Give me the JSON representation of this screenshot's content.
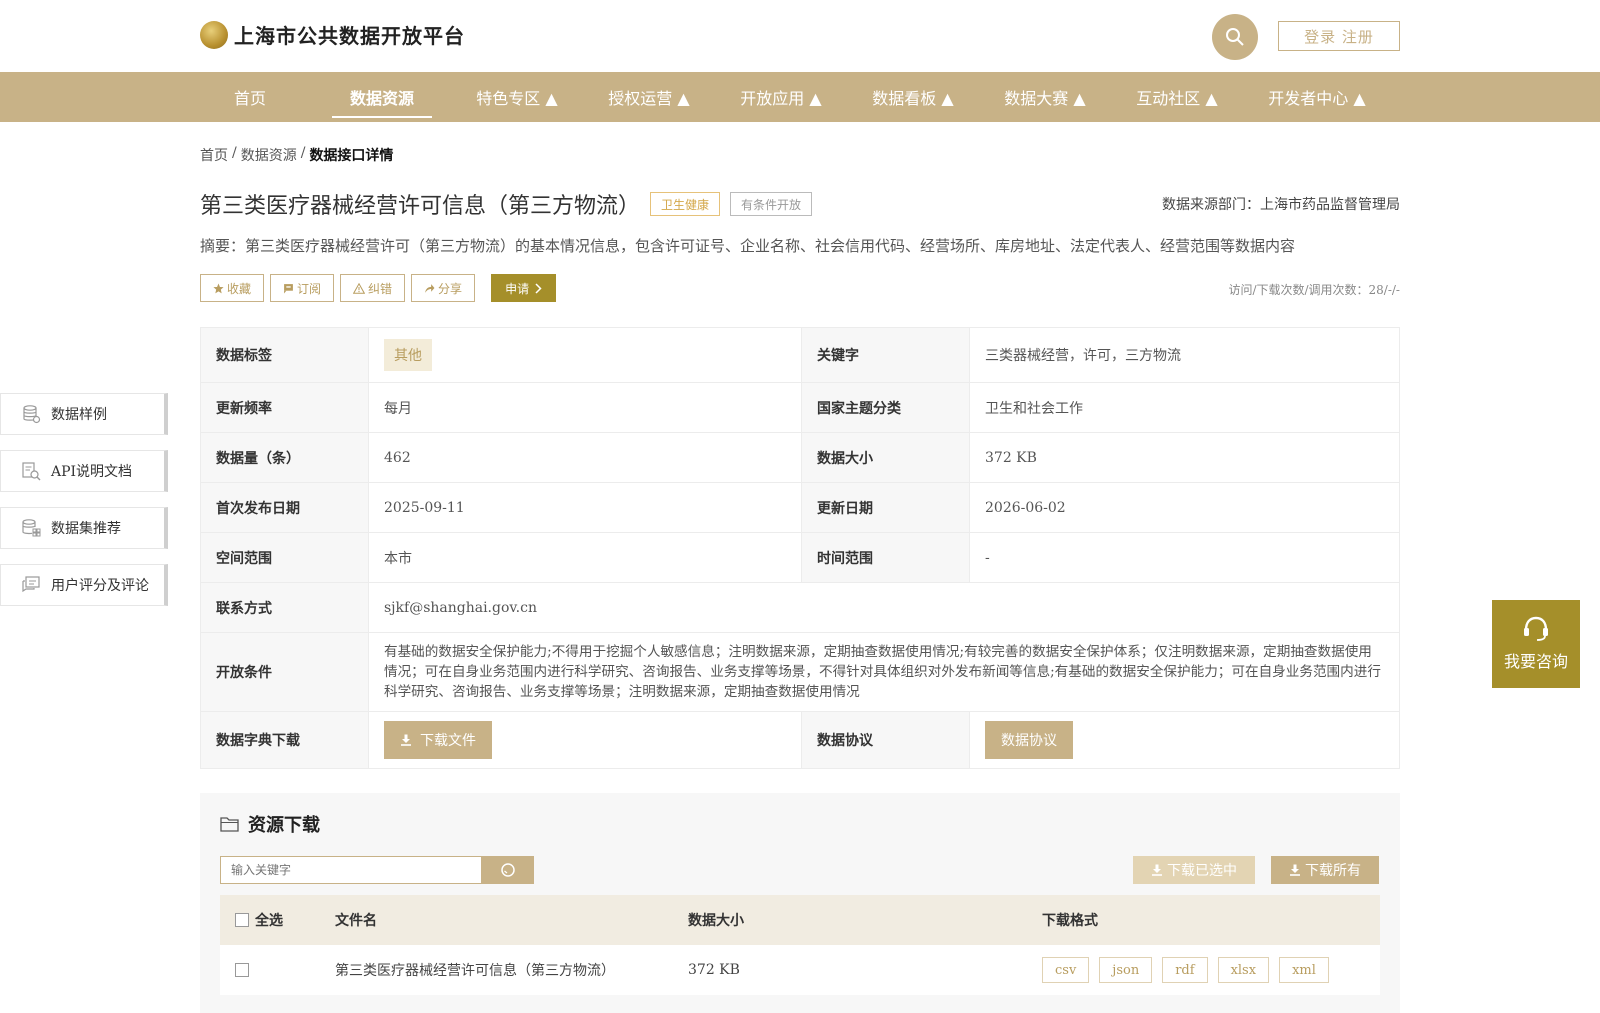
{
  "header": {
    "logo_text": "上海市公共数据开放平台",
    "search_icon": "search-icon",
    "login_label": "登录 注册"
  },
  "nav": {
    "items": [
      {
        "label": "首页"
      },
      {
        "label": "数据资源",
        "active": true
      },
      {
        "label": "特色专区 ▲"
      },
      {
        "label": "授权运营 ▲"
      },
      {
        "label": "开放应用 ▲"
      },
      {
        "label": "数据看板 ▲"
      },
      {
        "label": "数据大赛 ▲"
      },
      {
        "label": "互动社区 ▲"
      },
      {
        "label": "开发者中心 ▲"
      }
    ]
  },
  "breadcrumb": {
    "home": "首页",
    "sep1": "/",
    "resources": "数据资源",
    "sep2": "/",
    "current": "数据接口详情"
  },
  "dataset": {
    "title": "第三类医疗器械经营许可信息（第三方物流）",
    "tag_category": "卫生健康",
    "tag_open": "有条件开放",
    "source": "数据来源部门：上海市药品监督管理局",
    "summary": "摘要：第三类医疗器械经营许可（第三方物流）的基本情况信息，包含许可证号、企业名称、社会信用代码、经营场所、库房地址、法定代表人、经营范围等数据内容"
  },
  "actions": {
    "favorite": "收藏",
    "subscribe": "订阅",
    "report": "纠错",
    "share": "分享",
    "apply": "申请",
    "visits": "访问/下载次数/调用次数：28/-/-"
  },
  "info": {
    "tag_label": "数据标签",
    "tag_value": "其他",
    "keyword_label": "关键字",
    "keyword_value": "三类器械经营，许可，三方物流",
    "freq_label": "更新频率",
    "freq_value": "每月",
    "theme_label": "国家主题分类",
    "theme_value": "卫生和社会工作",
    "count_label": "数据量（条）",
    "count_value": "462",
    "size_label": "数据大小",
    "size_value": "372 KB",
    "first_pub_label": "首次发布日期",
    "first_pub_value": "2025-09-11",
    "update_label": "更新日期",
    "update_value": "2026-06-02",
    "space_label": "空间范围",
    "space_value": "本市",
    "time_label": "时间范围",
    "time_value": "-",
    "contact_label": "联系方式",
    "contact_value": "sjkf@shanghai.gov.cn",
    "cond_label": "开放条件",
    "cond_value": "有基础的数据安全保护能力;不得用于挖掘个人敏感信息；注明数据来源，定期抽查数据使用情况;有较完善的数据安全保护体系；仅注明数据来源，定期抽查数据使用情况；可在自身业务范围内进行科学研究、咨询报告、业务支撑等场景，不得针对具体组织对外发布新闻等信息;有基础的数据安全保护能力；可在自身业务范围内进行科学研究、咨询报告、业务支撑等场景；注明数据来源，定期抽查数据使用情况",
    "dict_label": "数据字典下载",
    "dict_btn": "下载文件",
    "protocol_label": "数据协议",
    "protocol_btn": "数据协议"
  },
  "side_nav": [
    {
      "label": "数据样例",
      "icon": "database-icon"
    },
    {
      "label": "API说明文档",
      "icon": "search-document-icon"
    },
    {
      "label": "数据集推荐",
      "icon": "database-grid-icon"
    },
    {
      "label": "用户评分及评论",
      "icon": "comment-icon"
    }
  ],
  "consult": {
    "label": "我要咨询",
    "icon": "headset-icon"
  },
  "resources": {
    "title": "资源下载",
    "search_placeholder": "输入关键字",
    "download_selected": "下载已选中",
    "download_all": "下载所有",
    "col_select_all": "全选",
    "col_filename": "文件名",
    "col_size": "数据大小",
    "col_format": "下载格式",
    "rows": [
      {
        "filename": "第三类医疗器械经营许可信息（第三方物流）",
        "size": "372 KB",
        "formats": [
          "csv",
          "json",
          "rdf",
          "xlsx",
          "xml"
        ]
      }
    ]
  },
  "colors": {
    "brand_gold": "#c8b287",
    "apply_olive": "#a58f2a"
  }
}
